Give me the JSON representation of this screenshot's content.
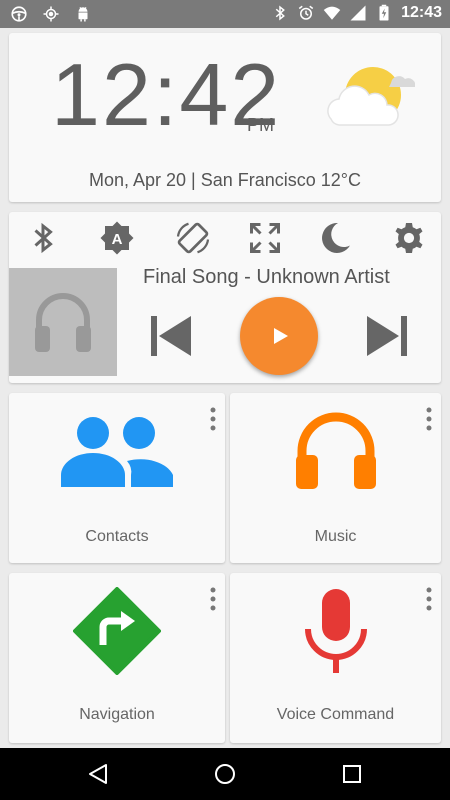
{
  "status_bar": {
    "time": "12:43",
    "left_icons": [
      "steering-wheel-icon",
      "gps-icon",
      "android-icon"
    ],
    "right_icons": [
      "bluetooth-icon",
      "alarm-icon",
      "wifi-icon",
      "signal-icon",
      "battery-charging-icon"
    ]
  },
  "clock": {
    "time": "12:42",
    "ampm": "PM",
    "date_location": "Mon, Apr 20 | San Francisco 12°C",
    "weather_icon": "partly-cloudy-icon"
  },
  "quick_settings": [
    "bluetooth-icon",
    "auto-brightness-icon",
    "screen-rotation-icon",
    "fullscreen-icon",
    "night-mode-icon",
    "settings-icon"
  ],
  "player": {
    "song": "Final Song - Unknown Artist",
    "album_art": "headphones-icon",
    "play_color": "#f5892e"
  },
  "apps": [
    {
      "label": "Contacts",
      "icon": "contacts-icon",
      "color": "#2196f3"
    },
    {
      "label": "Music",
      "icon": "music-headphones-icon",
      "color": "#ff7f00"
    },
    {
      "label": "Navigation",
      "icon": "navigation-icon",
      "color": "#27a130"
    },
    {
      "label": "Voice Command",
      "icon": "microphone-icon",
      "color": "#e53935"
    }
  ],
  "nav_bar": [
    "back-icon",
    "home-icon",
    "recents-icon"
  ]
}
